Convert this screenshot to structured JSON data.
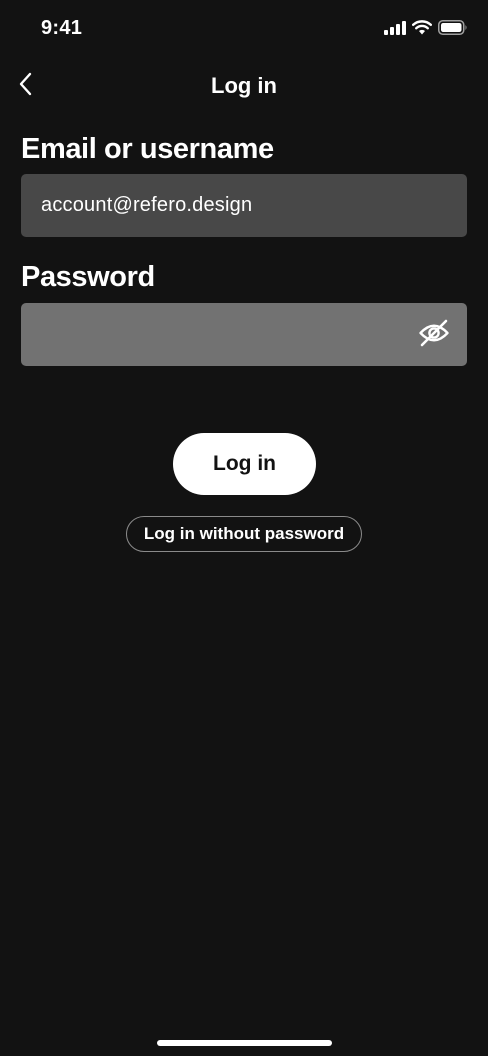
{
  "status_bar": {
    "time": "9:41",
    "icons": [
      "signal-icon",
      "wifi-icon",
      "battery-icon"
    ]
  },
  "nav": {
    "back_icon": "chevron-left-icon",
    "title": "Log in"
  },
  "form": {
    "email": {
      "label": "Email or username",
      "value": "account@refero.design"
    },
    "password": {
      "label": "Password",
      "value": "",
      "toggle_icon": "eye-slash-icon"
    }
  },
  "actions": {
    "login_label": "Log in",
    "login_without_password_label": "Log in without password"
  },
  "colors": {
    "background": "#121212",
    "email_field_bg": "#484848",
    "password_field_bg": "#727272",
    "primary_button_bg": "#ffffff",
    "text": "#ffffff"
  }
}
